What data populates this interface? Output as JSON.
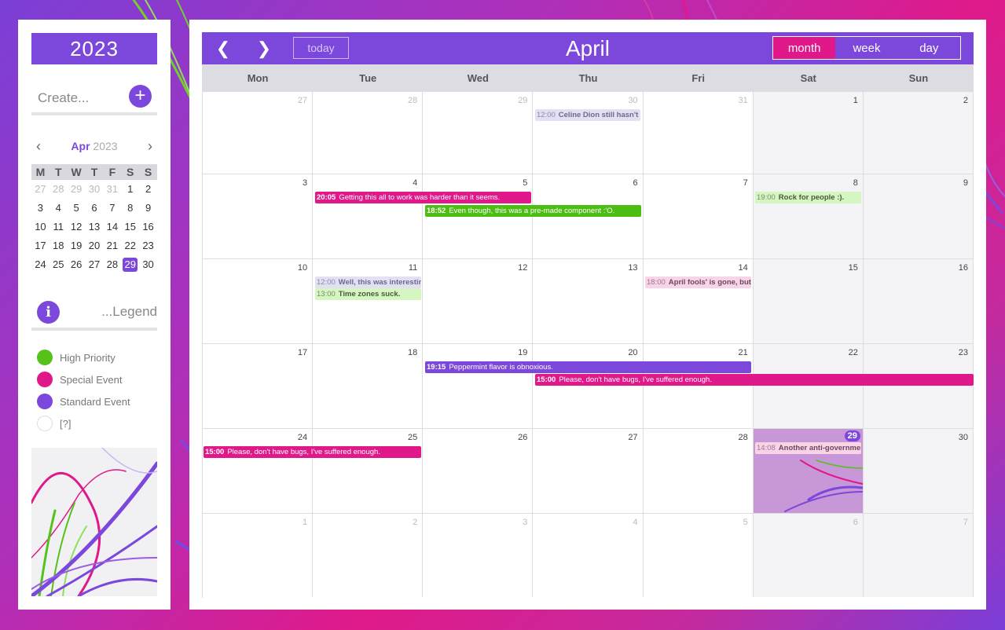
{
  "sidebar": {
    "year": "2023",
    "create_label": "Create...",
    "create_icon": "plus-icon",
    "mini": {
      "month": "Apr",
      "year": "2023",
      "weekdays": [
        "M",
        "T",
        "W",
        "T",
        "F",
        "S",
        "S"
      ],
      "days": [
        [
          "27",
          "28",
          "29",
          "30",
          "31",
          "1",
          "2"
        ],
        [
          "3",
          "4",
          "5",
          "6",
          "7",
          "8",
          "9"
        ],
        [
          "10",
          "11",
          "12",
          "13",
          "14",
          "15",
          "16"
        ],
        [
          "17",
          "18",
          "19",
          "20",
          "21",
          "22",
          "23"
        ],
        [
          "24",
          "25",
          "26",
          "27",
          "28",
          "29",
          "30"
        ]
      ],
      "selected": "29"
    },
    "legend_label": "...Legend",
    "legend_icon": "info-icon",
    "legend": [
      {
        "label": "High Priority",
        "color": "#55c21a"
      },
      {
        "label": "Special Event",
        "color": "#e0188a"
      },
      {
        "label": "Standard Event",
        "color": "#7c48db"
      },
      {
        "label": "[?]",
        "color": "#ffffff"
      }
    ]
  },
  "toolbar": {
    "prev_icon": "chevron-left-icon",
    "next_icon": "chevron-right-icon",
    "today_label": "today",
    "title": "April",
    "views": [
      "month",
      "week",
      "day"
    ],
    "active_view": "month"
  },
  "grid": {
    "weekdays": [
      "Mon",
      "Tue",
      "Wed",
      "Thu",
      "Fri",
      "Sat",
      "Sun"
    ],
    "weeks": [
      [
        "27",
        "28",
        "29",
        "30",
        "31",
        "1",
        "2"
      ],
      [
        "3",
        "4",
        "5",
        "6",
        "7",
        "8",
        "9"
      ],
      [
        "10",
        "11",
        "12",
        "13",
        "14",
        "15",
        "16"
      ],
      [
        "17",
        "18",
        "19",
        "20",
        "21",
        "22",
        "23"
      ],
      [
        "24",
        "25",
        "26",
        "27",
        "28",
        "29",
        "30"
      ],
      [
        "1",
        "2",
        "3",
        "4",
        "5",
        "6",
        "7"
      ]
    ],
    "today": "29"
  },
  "events": {
    "celine": {
      "time": "12:00",
      "title": "Celine Dion still hasn't co"
    },
    "getting": {
      "time": "20:05",
      "title": "Getting this all to work was harder than it seems."
    },
    "rock": {
      "time": "19:00",
      "title": "Rock for people :)."
    },
    "even": {
      "time": "18:52",
      "title": "Even though, this was a pre-made component :'O."
    },
    "well": {
      "time": "12:00",
      "title": "Well, this was interesting"
    },
    "timezones": {
      "time": "13:00",
      "title": "Time zones suck."
    },
    "aprilfools": {
      "time": "18:00",
      "title": "April fools' is gone, but I"
    },
    "peppermint": {
      "time": "19:15",
      "title": "Peppermint flavor is obnoxious."
    },
    "bugs1": {
      "time": "15:00",
      "title": "Please, don't have bugs, I've suffered enough."
    },
    "bugs2": {
      "time": "15:00",
      "title": "Please, don't have bugs, I've suffered enough."
    },
    "anti": {
      "time": "14:08",
      "title": "Another anti-governmen"
    }
  }
}
